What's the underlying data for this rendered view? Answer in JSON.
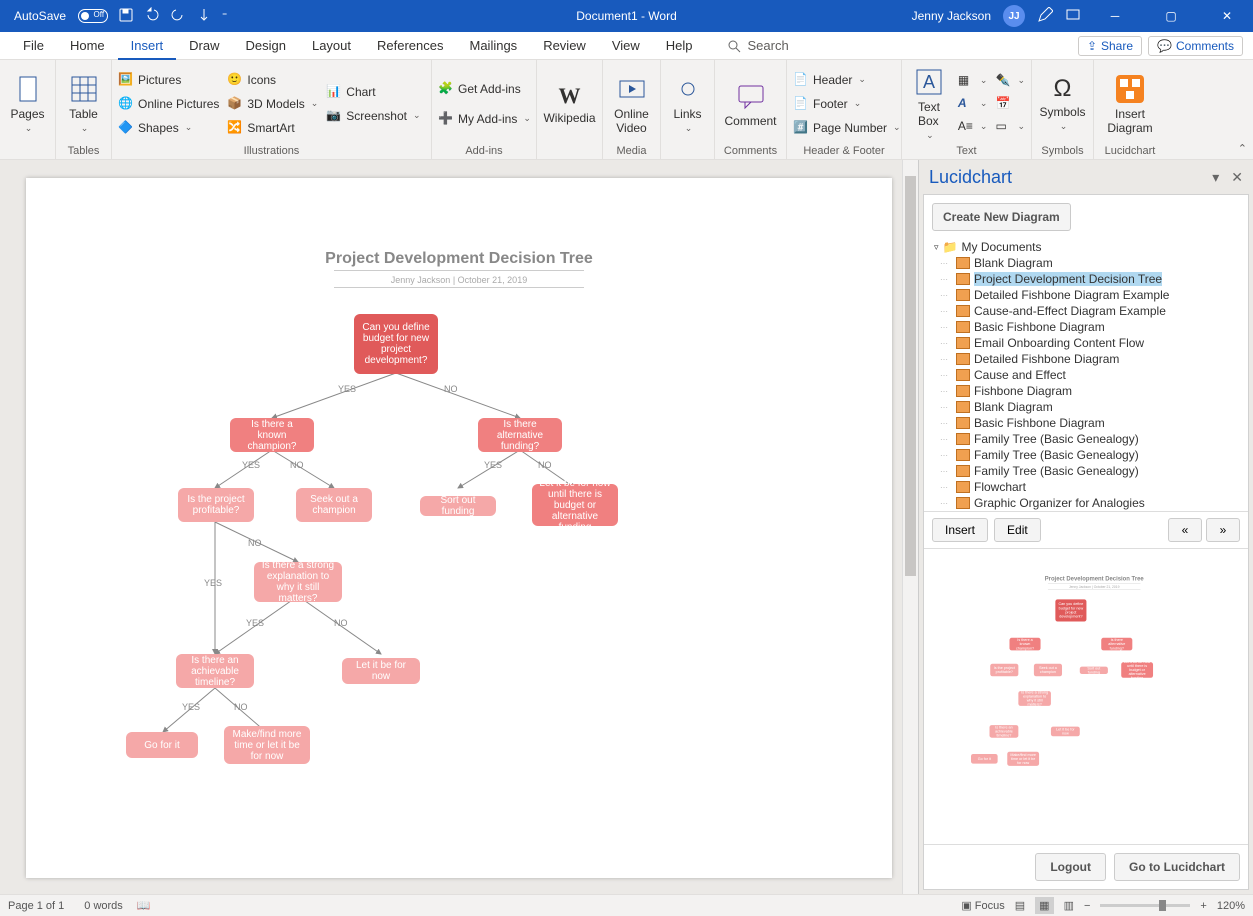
{
  "titlebar": {
    "autosave": "AutoSave",
    "doctitle": "Document1  -  Word",
    "username": "Jenny Jackson",
    "initials": "JJ"
  },
  "tabs": {
    "file": "File",
    "home": "Home",
    "insert": "Insert",
    "draw": "Draw",
    "design": "Design",
    "layout": "Layout",
    "references": "References",
    "mailings": "Mailings",
    "review": "Review",
    "view": "View",
    "help": "Help",
    "search": "Search",
    "share": "Share",
    "comments": "Comments"
  },
  "ribbon": {
    "pages": "Pages",
    "tables_group": "Tables",
    "table": "Table",
    "illustrations_group": "Illustrations",
    "pictures": "Pictures",
    "online_pictures": "Online Pictures",
    "shapes": "Shapes",
    "icons": "Icons",
    "models": "3D Models",
    "smartart": "SmartArt",
    "chart": "Chart",
    "screenshot": "Screenshot",
    "addins_group": "Add-ins",
    "get_addins": "Get Add-ins",
    "my_addins": "My Add-ins",
    "wikipedia": "Wikipedia",
    "media_group": "Media",
    "online_video": "Online\nVideo",
    "links": "Links",
    "comment": "Comment",
    "comments_group": "Comments",
    "header_footer_group": "Header & Footer",
    "header": "Header",
    "footer": "Footer",
    "page_number": "Page Number",
    "text_group": "Text",
    "text_box": "Text\nBox",
    "symbols_group": "Symbols",
    "symbols": "Symbols",
    "lucid_group": "Lucidchart",
    "insert_diagram": "Insert\nDiagram"
  },
  "flowchart": {
    "title": "Project Development Decision Tree",
    "subtitle": "Jenny Jackson  |  October 21, 2019",
    "n1": "Can you define budget for new project development?",
    "n2": "Is there a known champion?",
    "n3": "Is there alternative funding?",
    "n4": "Is the project profitable?",
    "n5": "Seek out a champion",
    "n6": "Sort out funding",
    "n7": "Let it be for now until there is budget or alternative funding",
    "n8": "Is there a strong explanation to why it still matters?",
    "n9": "Is there an achievable timeline?",
    "n10": "Let it be for now",
    "n11": "Go for it",
    "n12": "Make/find more time or let it be for now",
    "yes": "YES",
    "no": "NO"
  },
  "pane": {
    "title": "Lucidchart",
    "create": "Create New Diagram",
    "folder": "My Documents",
    "items": [
      "Blank Diagram",
      "Project Development Decision Tree",
      "Detailed Fishbone Diagram Example",
      "Cause-and-Effect Diagram Example",
      "Basic Fishbone Diagram",
      "Email Onboarding Content Flow",
      "Detailed Fishbone Diagram",
      "Cause and Effect",
      "Fishbone Diagram",
      "Blank Diagram",
      "Basic Fishbone Diagram",
      "Family Tree (Basic Genealogy)",
      "Family Tree (Basic Genealogy)",
      "Family Tree (Basic Genealogy)",
      "Flowchart",
      "Graphic Organizer for Analogies"
    ],
    "selected_index": 1,
    "insert": "Insert",
    "edit": "Edit",
    "prev": "«",
    "next": "»",
    "logout": "Logout",
    "goto": "Go to Lucidchart"
  },
  "status": {
    "page": "Page 1 of 1",
    "words": "0 words",
    "focus": "Focus",
    "zoom": "120%"
  }
}
